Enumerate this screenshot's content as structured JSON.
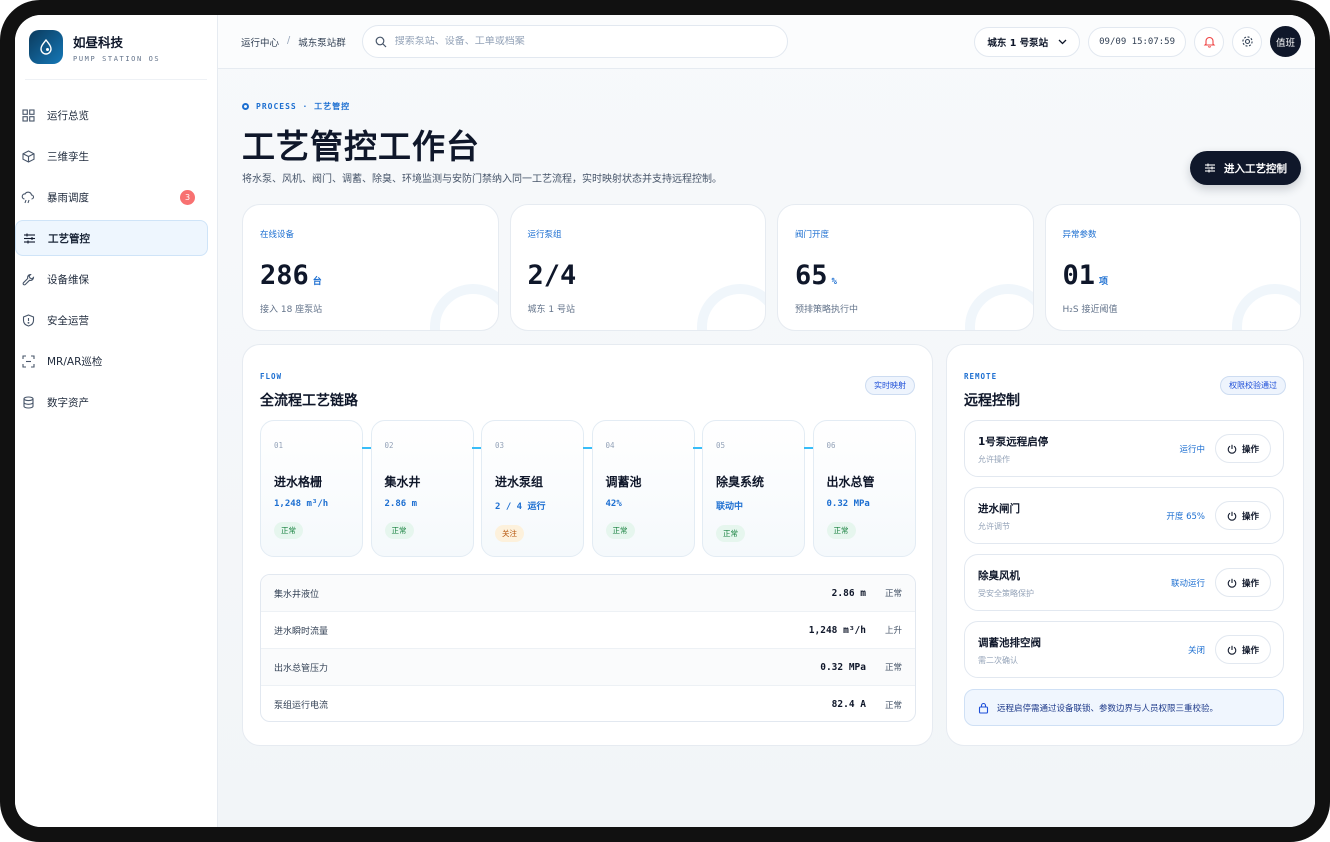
{
  "brand": {
    "name": "如昼科技",
    "sub": "PUMP STATION OS"
  },
  "nav": [
    {
      "label": "运行总览",
      "icon": "grid-icon"
    },
    {
      "label": "三维孪生",
      "icon": "cube-icon"
    },
    {
      "label": "暴雨调度",
      "icon": "rain-cloud-icon",
      "badge": "3"
    },
    {
      "label": "工艺管控",
      "icon": "sliders-icon",
      "active": true
    },
    {
      "label": "设备维保",
      "icon": "wrench-icon"
    },
    {
      "label": "安全运营",
      "icon": "shield-icon"
    },
    {
      "label": "MR/AR巡检",
      "icon": "scan-icon"
    },
    {
      "label": "数字资产",
      "icon": "database-icon"
    }
  ],
  "topbar": {
    "crumb1": "运行中心",
    "crumb_sep": "/",
    "crumb2": "城东泵站群",
    "search_placeholder": "搜索泵站、设备、工单或档案",
    "station": "城东 1 号泵站",
    "clock": "09/09 15:07:59",
    "user": "值班"
  },
  "hero": {
    "eyebrow": "PROCESS · 工艺管控",
    "title": "工艺管控工作台",
    "subtitle": "将水泵、风机、阀门、调蓄、除臭、环境监测与安防门禁纳入同一工艺流程，实时映射状态并支持远程控制。",
    "cta": "进入工艺控制"
  },
  "kpis": [
    {
      "label": "在线设备",
      "value": "286",
      "unit": "台",
      "desc": "接入 18 座泵站"
    },
    {
      "label": "运行泵组",
      "value": "2/4",
      "unit": "",
      "desc": "城东 1 号站"
    },
    {
      "label": "阀门开度",
      "value": "65",
      "unit": "%",
      "desc": "预排策略执行中"
    },
    {
      "label": "异常参数",
      "value": "01",
      "unit": "项",
      "desc": "H₂S 接近阈值"
    }
  ],
  "flow": {
    "tag": "FLOW",
    "title": "全流程工艺链路",
    "pill": "实时映射",
    "steps": [
      {
        "no": "01",
        "name": "进水格栅",
        "metric": "1,248 m³/h",
        "status": "正常"
      },
      {
        "no": "02",
        "name": "集水井",
        "metric": "2.86 m",
        "status": "正常"
      },
      {
        "no": "03",
        "name": "进水泵组",
        "metric": "2 / 4 运行",
        "status": "关注"
      },
      {
        "no": "04",
        "name": "调蓄池",
        "metric": "42%",
        "status": "正常"
      },
      {
        "no": "05",
        "name": "除臭系统",
        "metric": "联动中",
        "status": "正常"
      },
      {
        "no": "06",
        "name": "出水总管",
        "metric": "0.32 MPa",
        "status": "正常"
      }
    ],
    "rows": [
      {
        "label": "集水井液位",
        "value": "2.86 m",
        "status": "正常"
      },
      {
        "label": "进水瞬时流量",
        "value": "1,248 m³/h",
        "status": "上升"
      },
      {
        "label": "出水总管压力",
        "value": "0.32 MPa",
        "status": "正常"
      },
      {
        "label": "泵组运行电流",
        "value": "82.4 A",
        "status": "正常"
      }
    ]
  },
  "remote": {
    "tag": "REMOTE",
    "title": "远程控制",
    "pill": "权限校验通过",
    "op_label": "操作",
    "items": [
      {
        "name": "1号泵远程启停",
        "desc": "允许操作",
        "state": "运行中"
      },
      {
        "name": "进水闸门",
        "desc": "允许调节",
        "state": "开度 65%"
      },
      {
        "name": "除臭风机",
        "desc": "受安全策略保护",
        "state": "联动运行"
      },
      {
        "name": "调蓄池排空阀",
        "desc": "需二次确认",
        "state": "关闭"
      }
    ],
    "note": "远程启停需通过设备联锁、参数边界与人员权限三重校验。"
  },
  "colors": {
    "accent": "#1d6fd1",
    "dark": "#0f172a",
    "ok": "#15803d",
    "warn": "#b45309",
    "badge": "#f87171"
  }
}
